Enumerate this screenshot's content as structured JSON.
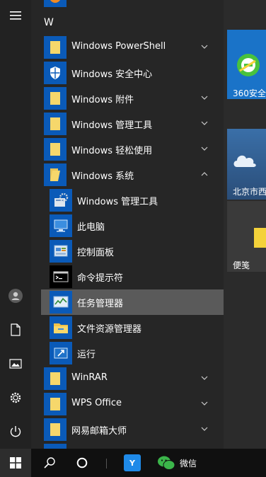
{
  "section_letter": "W",
  "apps": [
    {
      "label": "Windows PowerShell",
      "chevron": "down"
    },
    {
      "label": "Windows 安全中心",
      "chevron": ""
    },
    {
      "label": "Windows 附件",
      "chevron": "down"
    },
    {
      "label": "Windows 管理工具",
      "chevron": "down"
    },
    {
      "label": "Windows 轻松使用",
      "chevron": "down"
    },
    {
      "label": "Windows 系统",
      "chevron": "up"
    }
  ],
  "system_items": [
    {
      "label": "Windows 管理工具"
    },
    {
      "label": "此电脑"
    },
    {
      "label": "控制面板"
    },
    {
      "label": "命令提示符"
    },
    {
      "label": "任务管理器"
    },
    {
      "label": "文件资源管理器"
    },
    {
      "label": "运行"
    }
  ],
  "apps_after": [
    {
      "label": "WinRAR"
    },
    {
      "label": "WPS Office"
    },
    {
      "label": "网易邮箱大师"
    }
  ],
  "tiles": {
    "t360": "360安全",
    "weather": "北京市西",
    "notes": "便笺"
  },
  "taskbar": {
    "wechat_label": "微信"
  },
  "colors": {
    "accent": "#0a5ab8",
    "folder": "#f6d76b",
    "highlight": "#5a5a5a"
  },
  "icons": [
    "hamburger-icon",
    "user-icon",
    "document-icon",
    "pictures-icon",
    "settings-icon",
    "power-icon",
    "windows-logo-icon",
    "search-icon",
    "cortana-icon"
  ]
}
